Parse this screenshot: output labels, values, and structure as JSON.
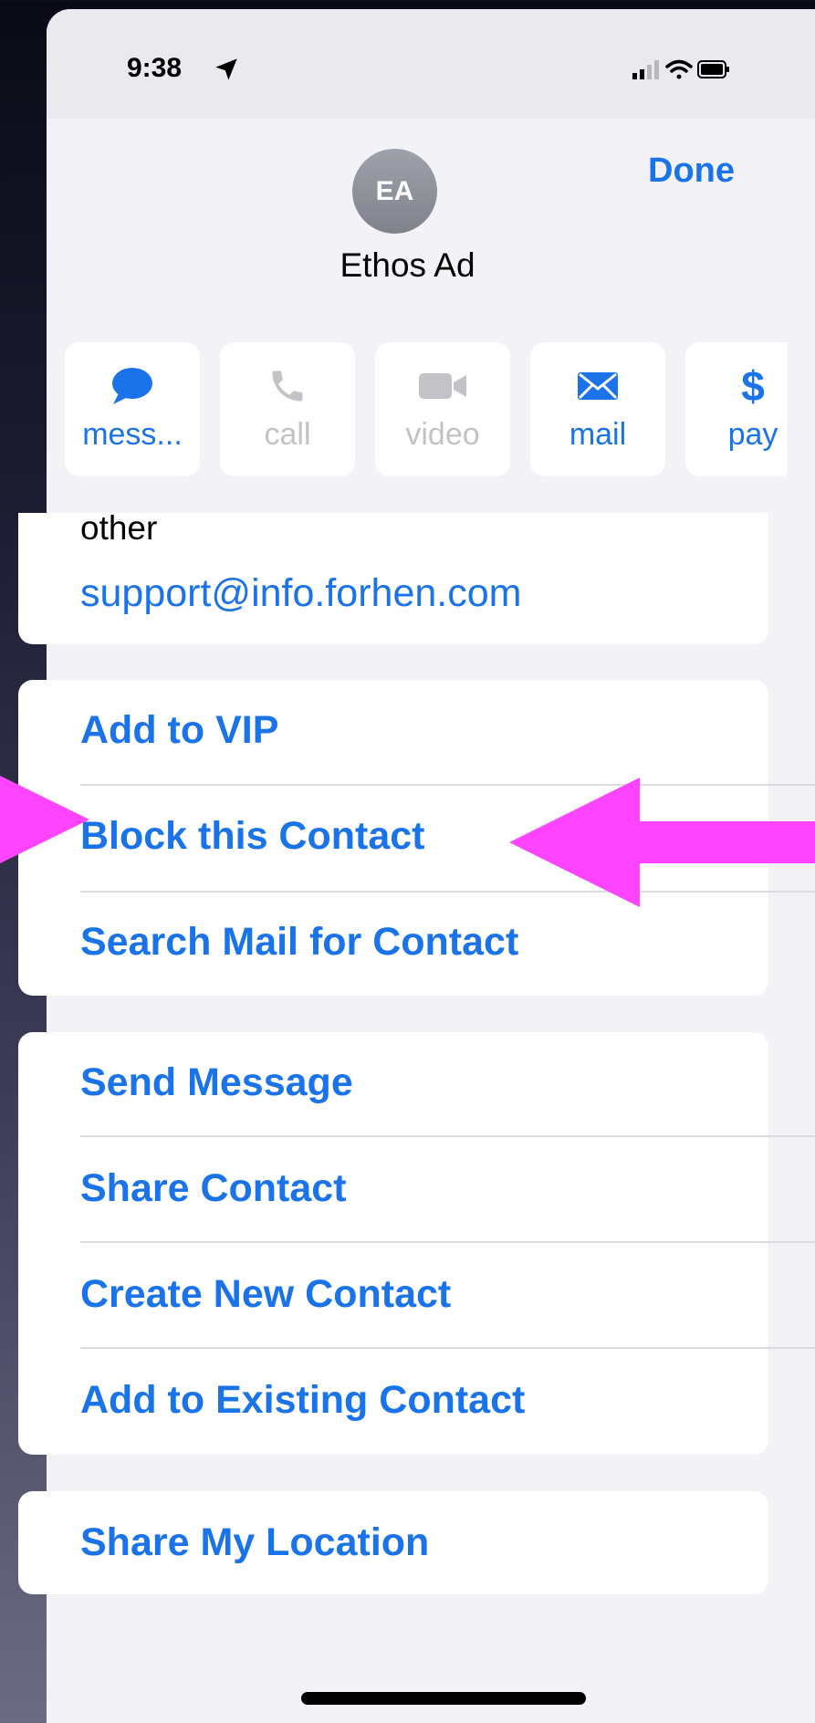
{
  "status_bar": {
    "time": "9:38"
  },
  "contact": {
    "initials": "EA",
    "name": "Ethos Ad"
  },
  "header": {
    "done_label": "Done"
  },
  "actions": [
    {
      "label": "mess...",
      "icon": "message-icon",
      "enabled": true
    },
    {
      "label": "call",
      "icon": "phone-icon",
      "enabled": false
    },
    {
      "label": "video",
      "icon": "video-icon",
      "enabled": false
    },
    {
      "label": "mail",
      "icon": "mail-icon",
      "enabled": true
    },
    {
      "label": "pay",
      "icon": "dollar-icon",
      "enabled": true
    }
  ],
  "email": {
    "label": "other",
    "value": "support@info.forhen.com"
  },
  "group1": {
    "add_vip": "Add to VIP",
    "block": "Block this Contact",
    "search_mail": "Search Mail for Contact"
  },
  "group2": {
    "send_message": "Send Message",
    "share_contact": "Share Contact",
    "create_new": "Create New Contact",
    "add_existing": "Add to Existing Contact"
  },
  "group3": {
    "share_location": "Share My Location"
  },
  "colors": {
    "accent": "#1a73e8",
    "annotation_arrow": "#ff44ff"
  }
}
